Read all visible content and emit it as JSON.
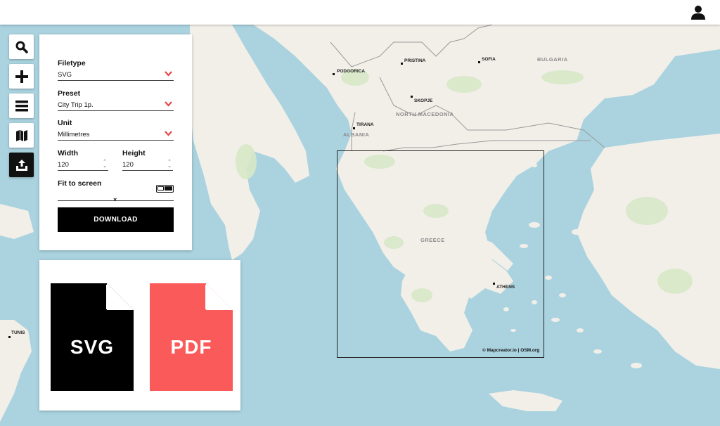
{
  "toolbar": {
    "tools": [
      {
        "icon": "search-icon"
      },
      {
        "icon": "plus-icon"
      },
      {
        "icon": "layers-icon"
      },
      {
        "icon": "map-icon"
      },
      {
        "icon": "export-icon",
        "active": true
      }
    ]
  },
  "topbar": {
    "user_icon": "user-icon"
  },
  "export_panel": {
    "filetype": {
      "label": "Filetype",
      "value": "SVG"
    },
    "preset": {
      "label": "Preset",
      "value": "City Trip 1p."
    },
    "unit": {
      "label": "Unit",
      "value": "Millimetres"
    },
    "width": {
      "label": "Width",
      "value": "120"
    },
    "height": {
      "label": "Height",
      "value": "120"
    },
    "times": "×",
    "fit_to_screen": {
      "label": "Fit to screen",
      "enabled": true
    },
    "download_label": "DOWNLOAD"
  },
  "formats": {
    "svg": {
      "label": "SVG",
      "color": "#000000"
    },
    "pdf": {
      "label": "PDF",
      "color": "#fa5a5a"
    }
  },
  "map": {
    "cities": [
      "PODGORICA",
      "PRISTINA",
      "SOFIA",
      "SKOPJE",
      "TIRANA",
      "ATHENS",
      "TUNIS"
    ],
    "countries": [
      "BULGARIA",
      "NORTH MACEDONIA",
      "ALBANIA",
      "GREECE"
    ],
    "attribution": "© Mapcreator.io | OSM.org",
    "colors": {
      "water": "#aad3df",
      "land": "#f2efe9",
      "park": "#d8e8c8"
    }
  }
}
